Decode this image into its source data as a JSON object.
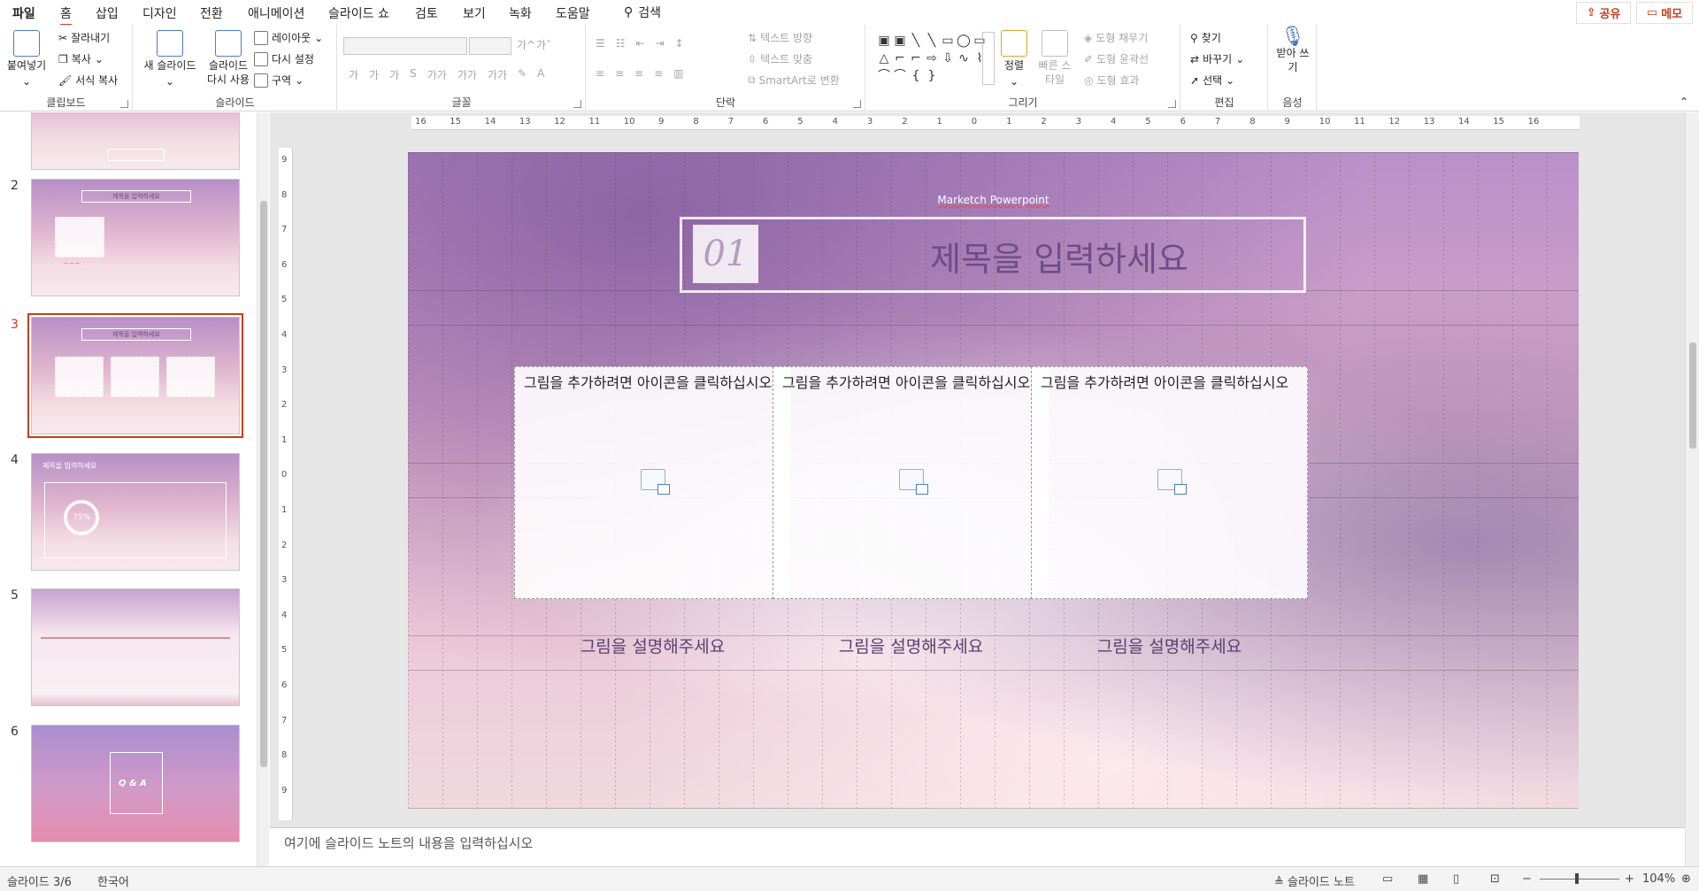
{
  "tabs": [
    "파일",
    "홈",
    "삽입",
    "디자인",
    "전환",
    "애니메이션",
    "슬라이드 쇼",
    "검토",
    "보기",
    "녹화",
    "도움말"
  ],
  "search_label": "검색",
  "share_label": "공유",
  "memo_label": "메모",
  "ribbon": {
    "clipboard": {
      "label": "클립보드",
      "paste": "붙여넣기",
      "cut": "잘라내기",
      "copy": "복사",
      "format_painter": "서식 복사"
    },
    "slides": {
      "label": "슬라이드",
      "new_slide": "새 슬라이드",
      "reuse_slide": "슬라이드 다시 사용",
      "layout": "레이아웃",
      "reset": "다시 설정",
      "section": "구역"
    },
    "font": {
      "label": "글꼴",
      "size_up": "가^",
      "size_down": "가ˇ",
      "row2": [
        "가",
        "가",
        "가",
        "S",
        "가가",
        "가가",
        "가가"
      ]
    },
    "paragraph": {
      "label": "단락",
      "text_direction": "텍스트 방향",
      "align_text": "텍스트 맞춤",
      "smartart": "SmartArt로 변환"
    },
    "drawing": {
      "label": "그리기",
      "arrange": "정렬",
      "quick_styles": "빠른 스타일",
      "shape_fill": "도형 채우기",
      "shape_outline": "도형 윤곽선",
      "shape_effects": "도형 효과"
    },
    "editing": {
      "label": "편집",
      "find": "찾기",
      "replace": "바꾸기",
      "select": "선택"
    },
    "voice": {
      "label": "음성",
      "dictate": "받아 쓰기"
    }
  },
  "thumbnails": [
    {
      "num": "2",
      "title": "제목을 입력하세요"
    },
    {
      "num": "3",
      "title": "제목을 입력하세요"
    },
    {
      "num": "4",
      "title": "제목을 입력하세요"
    },
    {
      "num": "5",
      "title": ""
    },
    {
      "num": "6",
      "title": "Q & A"
    }
  ],
  "thumb4_percent": "75%",
  "slide": {
    "brand": "Marketch Powerpoint",
    "number": "01",
    "title": "제목을 입력하세요",
    "placeholder_prompt": "그림을 추가하려면 아이콘을 클릭하십시오",
    "captions": [
      "그림을 설명해주세요",
      "그림을 설명해주세요",
      "그림을 설명해주세요"
    ]
  },
  "ruler_h": [
    "16",
    "15",
    "14",
    "13",
    "12",
    "11",
    "10",
    "9",
    "8",
    "7",
    "6",
    "5",
    "4",
    "3",
    "2",
    "1",
    "0",
    "1",
    "2",
    "3",
    "4",
    "5",
    "6",
    "7",
    "8",
    "9",
    "10",
    "11",
    "12",
    "13",
    "14",
    "15",
    "16"
  ],
  "ruler_v": [
    "9",
    "8",
    "7",
    "6",
    "5",
    "4",
    "3",
    "2",
    "1",
    "0",
    "1",
    "2",
    "3",
    "4",
    "5",
    "6",
    "7",
    "8",
    "9"
  ],
  "notes_placeholder": "여기에 슬라이드 노트의 내용을 입력하십시오",
  "status": {
    "slide_count": "슬라이드 3/6",
    "language": "한국어",
    "notes": "슬라이드 노트",
    "zoom": "104%"
  }
}
